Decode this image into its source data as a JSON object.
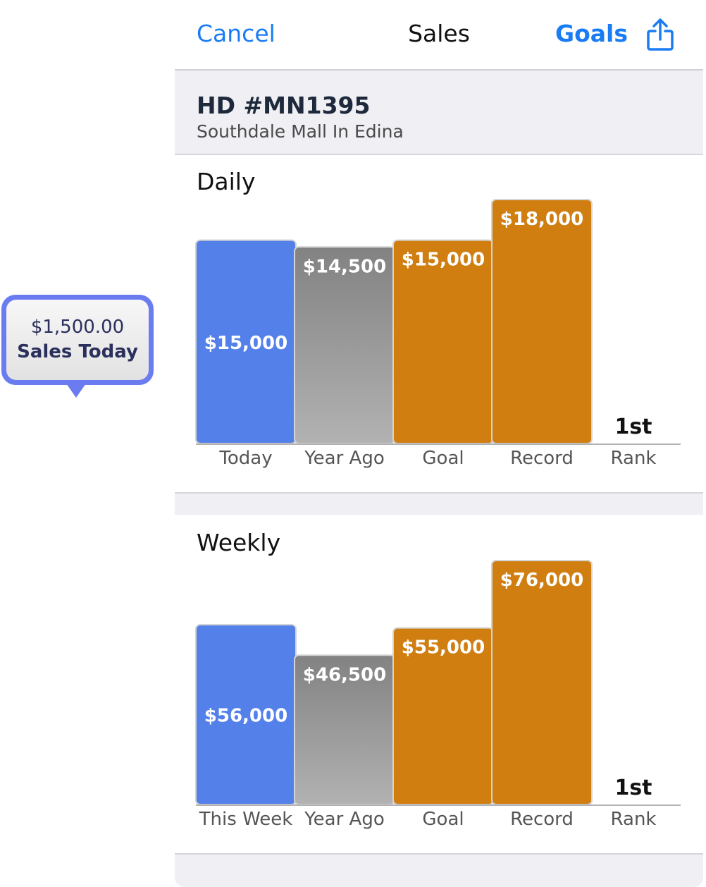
{
  "callout": {
    "value": "$1,500.00",
    "label": "Sales Today",
    "color": "#6a7cf0"
  },
  "navbar": {
    "cancel_label": "Cancel",
    "title": "Sales",
    "goals_label": "Goals",
    "share_icon": "share-icon",
    "accent": "#1a7cf4"
  },
  "store": {
    "id": "HD #MN1395",
    "name": "Southdale Mall In Edina"
  },
  "colors": {
    "current": "#5480ea",
    "year_ago": "#8a8a8a",
    "goal": "#d07e10",
    "record": "#d07e10"
  },
  "chart_data": [
    {
      "type": "bar",
      "title": "Daily",
      "categories": [
        "Today",
        "Year Ago",
        "Goal",
        "Record"
      ],
      "values": [
        15000,
        14500,
        15000,
        18000
      ],
      "value_labels": [
        "$15,000",
        "$14,500",
        "$15,000",
        "$18,000"
      ],
      "rank_category": "Rank",
      "rank": "1st"
    },
    {
      "type": "bar",
      "title": "Weekly",
      "categories": [
        "This Week",
        "Year Ago",
        "Goal",
        "Record"
      ],
      "values": [
        56000,
        46500,
        55000,
        76000
      ],
      "value_labels": [
        "$56,000",
        "$46,500",
        "$55,000",
        "$76,000"
      ],
      "rank_category": "Rank",
      "rank": "1st"
    }
  ]
}
